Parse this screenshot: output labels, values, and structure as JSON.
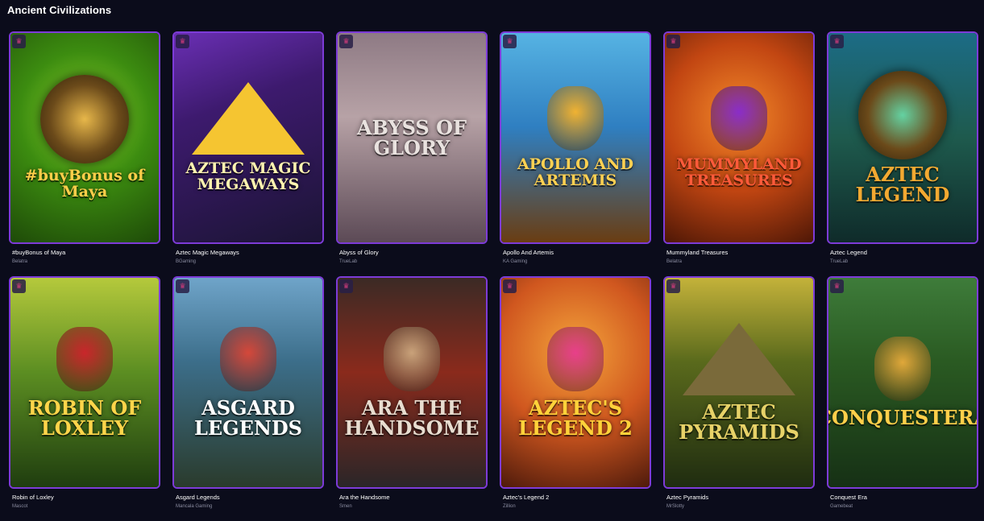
{
  "section": {
    "title": "Ancient Civilizations"
  },
  "games": [
    {
      "name": "#buyBonus of Maya",
      "provider": "Belatra",
      "art_text": "#buyBonus of Maya",
      "bg": "radial-gradient(circle at 50% 40%, #8bd12c 0%, #3c8c10 45%, #1e4a08 100%)",
      "accent": "#e7b74a",
      "text_color": "#ffce4a",
      "motif": "emblem"
    },
    {
      "name": "Aztec Magic Megaways",
      "provider": "BGaming",
      "art_text": "AZTEC MAGIC MEGAWAYS",
      "bg": "linear-gradient(160deg, #6a2fb4 0%, #3d1a6e 35%, #1b1434 100%)",
      "accent": "#f5c531",
      "text_color": "#fff3b0",
      "motif": "pyramid"
    },
    {
      "name": "Abyss of Glory",
      "provider": "TrueLab",
      "art_text": "ABYSS OF GLORY",
      "bg": "linear-gradient(180deg, #8e7a84 0%, #b7a2a6 40%, #5c4a56 100%)",
      "accent": "#3b3847",
      "text_color": "#e9e2df",
      "motif": "none"
    },
    {
      "name": "Apollo And Artemis",
      "provider": "KA Gaming",
      "art_text": "APOLLO AND ARTEMIS",
      "bg": "linear-gradient(180deg, #56b3e3 0%, #2f7fc1 45%, #6a3d12 100%)",
      "accent": "#f0b232",
      "text_color": "#ffd152",
      "motif": "face"
    },
    {
      "name": "Mummyland Treasures",
      "provider": "Belatra",
      "art_text": "MUMMYLAND TREASURES",
      "bg": "radial-gradient(circle at 50% 40%, #f38a2a 0%, #c24612 50%, #4e1706 100%)",
      "accent": "#8a2dc9",
      "text_color": "#ff5a3a",
      "motif": "face"
    },
    {
      "name": "Aztec Legend",
      "provider": "TrueLab",
      "art_text": "AZTEC LEGEND",
      "bg": "linear-gradient(180deg, #1c6c86 0%, #1e5a4d 50%, #0f2b2a 100%)",
      "accent": "#64d2a2",
      "text_color": "#f2a931",
      "motif": "emblem"
    },
    {
      "name": "Robin of Loxley",
      "provider": "Mascot",
      "art_text": "ROBIN OF LOXLEY",
      "bg": "linear-gradient(180deg, #b5c93c 0%, #5c8e22 45%, #1f3d0f 100%)",
      "accent": "#c9262b",
      "text_color": "#ffd54a",
      "motif": "face"
    },
    {
      "name": "Asgard Legends",
      "provider": "Mancala Gaming",
      "art_text": "ASGARD LEGENDS",
      "bg": "linear-gradient(180deg, #6fa4c9 0%, #3c6e8a 40%, #2a3b2c 100%)",
      "accent": "#d5483a",
      "text_color": "#ffffff",
      "motif": "face"
    },
    {
      "name": "Ara the Handsome",
      "provider": "Smen",
      "art_text": "ARA THE HANDSOME",
      "bg": "linear-gradient(180deg, #3b2a25 0%, #8a2a1c 45%, #2a2628 100%)",
      "accent": "#c9a27a",
      "text_color": "#e8ddd0",
      "motif": "face"
    },
    {
      "name": "Aztec's Legend 2",
      "provider": "Zillion",
      "art_text": "AZTEC'S LEGEND 2",
      "bg": "radial-gradient(circle at 50% 35%, #f4a43b 0%, #d0571f 50%, #4e1a0b 100%)",
      "accent": "#e83f8a",
      "text_color": "#ffd23a",
      "motif": "face"
    },
    {
      "name": "Aztec Pyramids",
      "provider": "MrSlotty",
      "art_text": "AZTEC PYRAMIDS",
      "bg": "linear-gradient(180deg, #c4b23a 0%, #5a6a1c 40%, #1f2c10 100%)",
      "accent": "#7a6a3a",
      "text_color": "#e7d268",
      "motif": "pyramid"
    },
    {
      "name": "Conquest Era",
      "provider": "Gamebeat",
      "art_text": "CONQUESTERA",
      "bg": "linear-gradient(180deg, #3e7c3a 0%, #2a5a22 40%, #163015 100%)",
      "accent": "#e0a83a",
      "text_color": "#ffcf4a",
      "motif": "face"
    }
  ],
  "icons": {
    "favorite": "crown-icon"
  }
}
